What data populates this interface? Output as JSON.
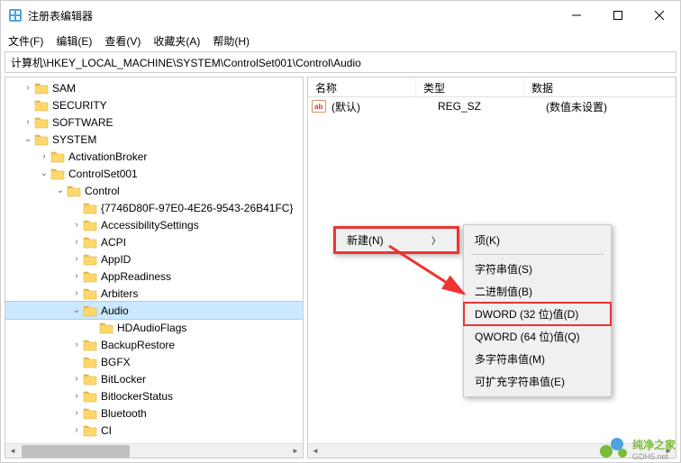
{
  "titlebar": {
    "title": "注册表编辑器"
  },
  "menubar": {
    "file": "文件(F)",
    "edit": "编辑(E)",
    "view": "查看(V)",
    "favorites": "收藏夹(A)",
    "help": "帮助(H)"
  },
  "path": "计算机\\HKEY_LOCAL_MACHINE\\SYSTEM\\ControlSet001\\Control\\Audio",
  "tree": [
    {
      "depth": 1,
      "exp": ">",
      "label": "SAM"
    },
    {
      "depth": 1,
      "exp": "",
      "label": "SECURITY"
    },
    {
      "depth": 1,
      "exp": ">",
      "label": "SOFTWARE"
    },
    {
      "depth": 1,
      "exp": "v",
      "label": "SYSTEM"
    },
    {
      "depth": 2,
      "exp": ">",
      "label": "ActivationBroker"
    },
    {
      "depth": 2,
      "exp": "v",
      "label": "ControlSet001"
    },
    {
      "depth": 3,
      "exp": "v",
      "label": "Control"
    },
    {
      "depth": 4,
      "exp": "",
      "label": "{7746D80F-97E0-4E26-9543-26B41FC}"
    },
    {
      "depth": 4,
      "exp": ">",
      "label": "AccessibilitySettings"
    },
    {
      "depth": 4,
      "exp": ">",
      "label": "ACPI"
    },
    {
      "depth": 4,
      "exp": ">",
      "label": "AppID"
    },
    {
      "depth": 4,
      "exp": ">",
      "label": "AppReadiness"
    },
    {
      "depth": 4,
      "exp": ">",
      "label": "Arbiters"
    },
    {
      "depth": 4,
      "exp": "v",
      "label": "Audio",
      "selected": true
    },
    {
      "depth": 5,
      "exp": "",
      "label": "HDAudioFlags"
    },
    {
      "depth": 4,
      "exp": ">",
      "label": "BackupRestore"
    },
    {
      "depth": 4,
      "exp": "",
      "label": "BGFX"
    },
    {
      "depth": 4,
      "exp": ">",
      "label": "BitLocker"
    },
    {
      "depth": 4,
      "exp": ">",
      "label": "BitlockerStatus"
    },
    {
      "depth": 4,
      "exp": ">",
      "label": "Bluetooth"
    },
    {
      "depth": 4,
      "exp": ">",
      "label": "CI"
    }
  ],
  "list": {
    "headers": {
      "name": "名称",
      "type": "类型",
      "data": "数据"
    },
    "rows": [
      {
        "name": "(默认)",
        "type": "REG_SZ",
        "data": "(数值未设置)"
      }
    ]
  },
  "ctx": {
    "new": "新建(N)"
  },
  "submenu": {
    "key": "项(K)",
    "string": "字符串值(S)",
    "binary": "二进制值(B)",
    "dword": "DWORD (32 位)值(D)",
    "qword": "QWORD (64 位)值(Q)",
    "multi": "多字符串值(M)",
    "expand": "可扩充字符串值(E)"
  },
  "watermark": {
    "text": "纯净之家",
    "url": "GDH5.net"
  }
}
